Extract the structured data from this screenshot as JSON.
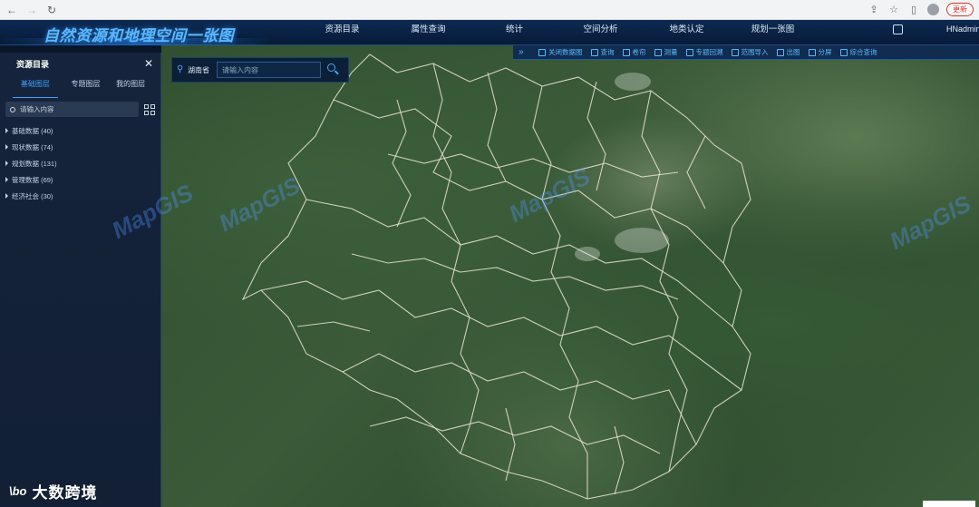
{
  "app": {
    "title": "自然资源和地理空间一张图",
    "username": "HNadmin"
  },
  "browser": {
    "update_label": "更新"
  },
  "main_nav": [
    {
      "label": "资源目录"
    },
    {
      "label": "属性查询"
    },
    {
      "label": "统计"
    },
    {
      "label": "空间分析"
    },
    {
      "label": "地类认定"
    },
    {
      "label": "规划一张图"
    }
  ],
  "toolbar": [
    {
      "label": "关闭数据图"
    },
    {
      "label": "查询"
    },
    {
      "label": "卷帘"
    },
    {
      "label": "测量"
    },
    {
      "label": "专题回溯"
    },
    {
      "label": "范围导入"
    },
    {
      "label": "出图"
    },
    {
      "label": "分屏"
    },
    {
      "label": "综合查询"
    }
  ],
  "map_search": {
    "region": "湖南省",
    "placeholder": "请输入内容"
  },
  "sidebar": {
    "title": "资源目录",
    "tabs": [
      {
        "label": "基础图层",
        "active": true
      },
      {
        "label": "专题图层",
        "active": false
      },
      {
        "label": "我的图层",
        "active": false
      }
    ],
    "search_placeholder": "请输入内容",
    "tree": [
      {
        "label": "基础数据 (40)"
      },
      {
        "label": "现状数据 (74)"
      },
      {
        "label": "规划数据 (131)"
      },
      {
        "label": "管理数据 (69)"
      },
      {
        "label": "经济社会 (30)"
      }
    ]
  },
  "map_watermark": "MapGIS",
  "watermark": {
    "logo": "\\bo",
    "text": "大数跨境"
  },
  "colors": {
    "accent": "#3fa3ff",
    "header_bg": "#0d2a52",
    "sidebar_bg": "#15243c"
  }
}
